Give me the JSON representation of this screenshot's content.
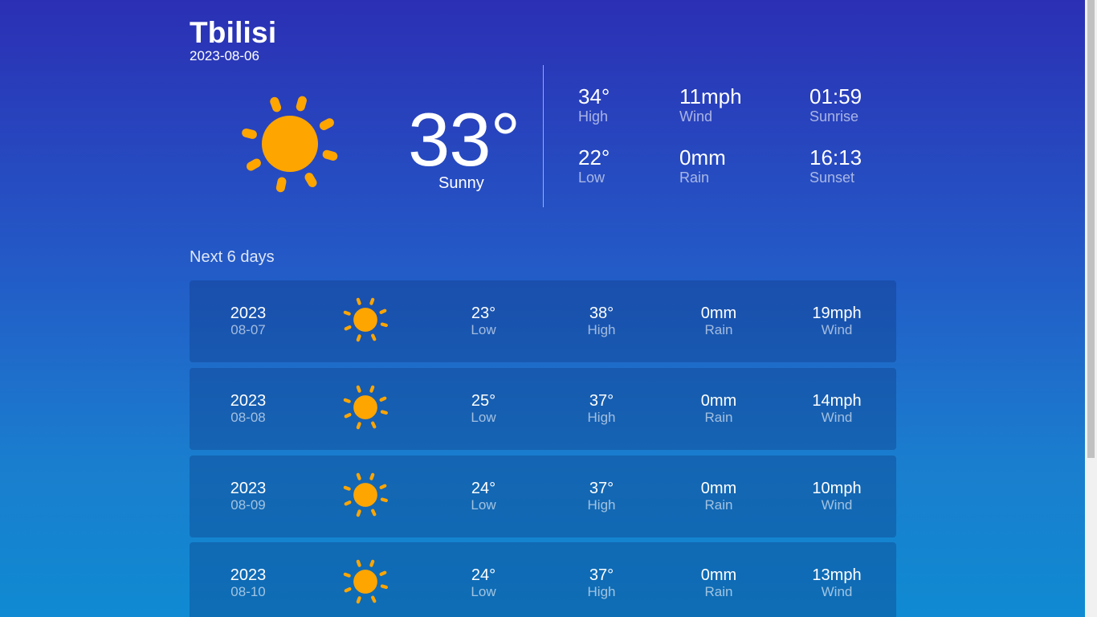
{
  "location": {
    "city": "Tbilisi",
    "date": "2023-08-06"
  },
  "current": {
    "icon": "sun-icon",
    "temperature": "33°",
    "condition": "Sunny",
    "stats": [
      {
        "value": "34°",
        "label": "High"
      },
      {
        "value": "11mph",
        "label": "Wind"
      },
      {
        "value": "01:59",
        "label": "Sunrise"
      },
      {
        "value": "22°",
        "label": "Low"
      },
      {
        "value": "0mm",
        "label": "Rain"
      },
      {
        "value": "16:13",
        "label": "Sunset"
      }
    ]
  },
  "forecast": {
    "title": "Next 6 days",
    "days": [
      {
        "year": "2023",
        "date": "08-07",
        "icon": "sun-icon",
        "low": "23°",
        "low_label": "Low",
        "high": "38°",
        "high_label": "High",
        "rain": "0mm",
        "rain_label": "Rain",
        "wind": "19mph",
        "wind_label": "Wind"
      },
      {
        "year": "2023",
        "date": "08-08",
        "icon": "sun-icon",
        "low": "25°",
        "low_label": "Low",
        "high": "37°",
        "high_label": "High",
        "rain": "0mm",
        "rain_label": "Rain",
        "wind": "14mph",
        "wind_label": "Wind"
      },
      {
        "year": "2023",
        "date": "08-09",
        "icon": "sun-icon",
        "low": "24°",
        "low_label": "Low",
        "high": "37°",
        "high_label": "High",
        "rain": "0mm",
        "rain_label": "Rain",
        "wind": "10mph",
        "wind_label": "Wind"
      },
      {
        "year": "2023",
        "date": "08-10",
        "icon": "sun-icon",
        "low": "24°",
        "low_label": "Low",
        "high": "37°",
        "high_label": "High",
        "rain": "0mm",
        "rain_label": "Rain",
        "wind": "13mph",
        "wind_label": "Wind"
      }
    ]
  },
  "colors": {
    "sun": "#ffa500",
    "background_top": "#2b2fb4",
    "background_bottom": "#108ad2"
  }
}
